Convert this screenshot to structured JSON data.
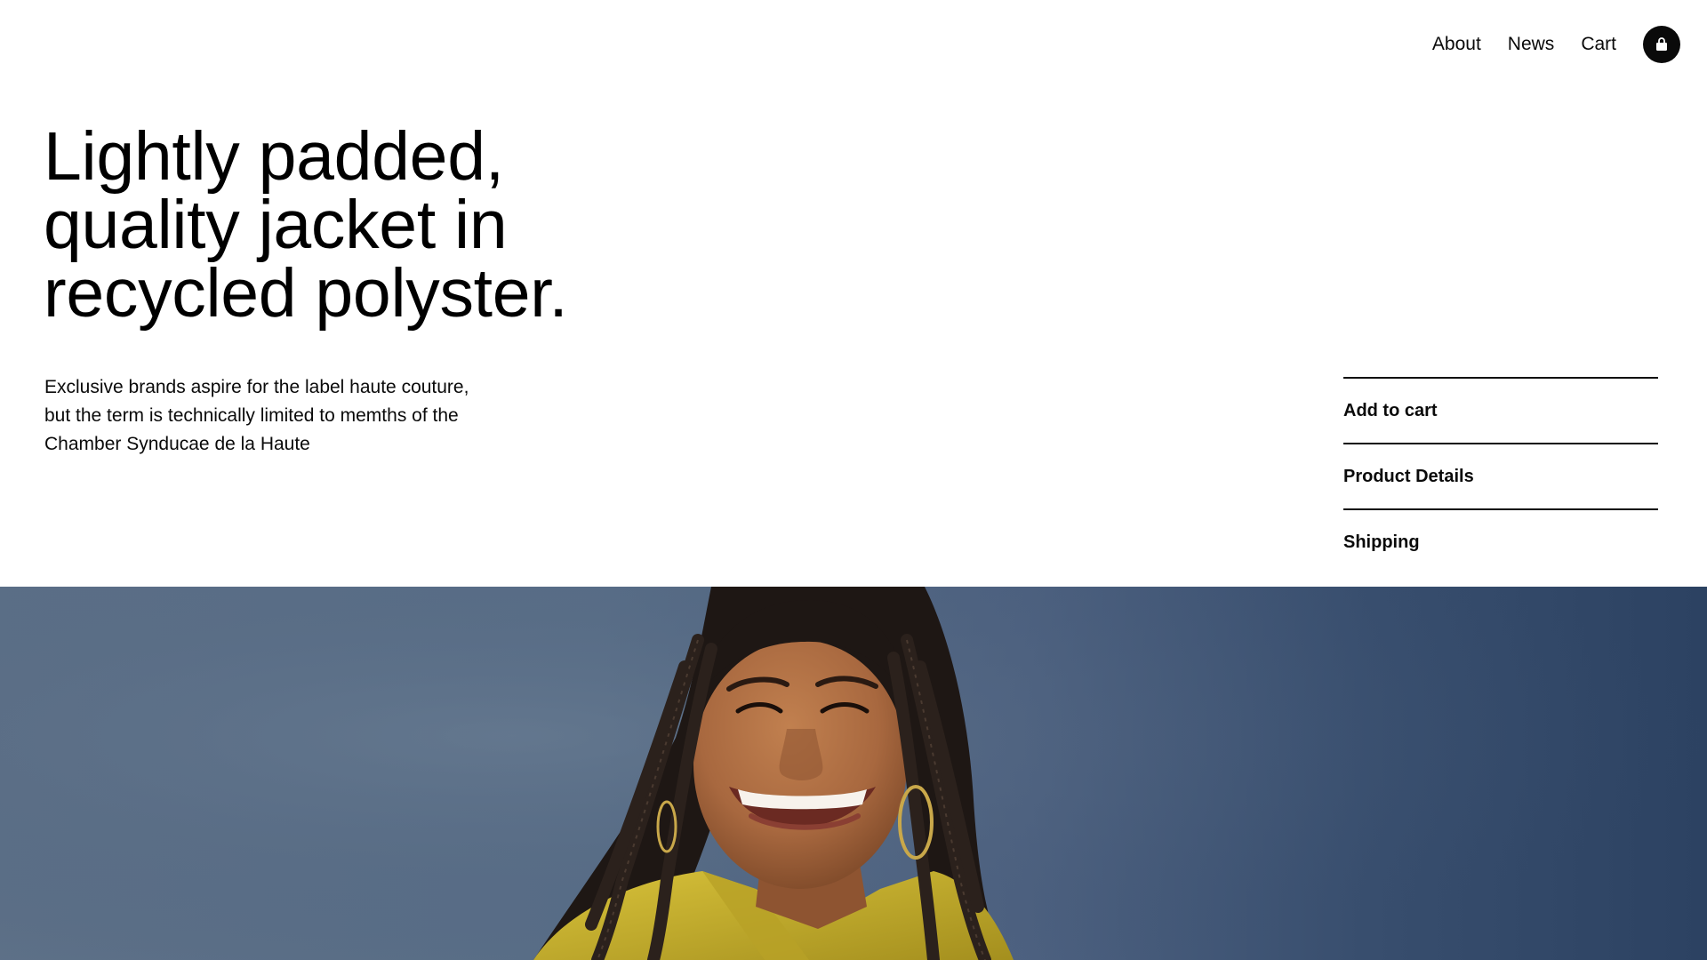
{
  "nav": {
    "links": [
      {
        "label": "About"
      },
      {
        "label": "News"
      },
      {
        "label": "Cart"
      }
    ],
    "bag_icon": "shopping-bag-icon"
  },
  "hero": {
    "headline_lines": [
      "Lightly padded,",
      "quality jacket in",
      "recycled polyster."
    ],
    "description": "Exclusive brands aspire for the label haute couture, but the term is technically limited to memths of the Chamber Synducae de la Haute"
  },
  "accordion": {
    "items": [
      {
        "label": "Add to cart"
      },
      {
        "label": "Product Details"
      },
      {
        "label": "Shipping"
      }
    ]
  },
  "photo": {
    "subject": "smiling-woman-photo",
    "colors": {
      "background": "#4f6482",
      "skin": "#a8683f",
      "hair": "#1e1714",
      "jacket": "#c8b02e"
    }
  }
}
